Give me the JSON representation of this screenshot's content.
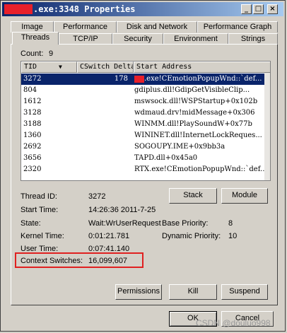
{
  "window": {
    "title": ".exe:3348 Properties",
    "minimize_glyph": "_",
    "maximize_glyph": "□",
    "close_glyph": "×"
  },
  "tabs_row1": [
    {
      "label": "Image"
    },
    {
      "label": "Performance"
    },
    {
      "label": "Disk and Network"
    },
    {
      "label": "Performance Graph"
    }
  ],
  "tabs_row2": [
    {
      "label": "Threads"
    },
    {
      "label": "TCP/IP"
    },
    {
      "label": "Security"
    },
    {
      "label": "Environment"
    },
    {
      "label": "Strings"
    }
  ],
  "count": {
    "label": "Count:",
    "value": "9"
  },
  "table": {
    "columns": [
      "TID",
      "CSwitch Delta",
      "Start Address"
    ],
    "sort_glyph": "▼",
    "rows": [
      {
        "tid": "3272",
        "delta": "178",
        "addr": ".exe!CEmotionPopupWnd::`def...",
        "selected": true
      },
      {
        "tid": "804",
        "delta": "",
        "addr": "gdiplus.dll!GdipGetVisibleClip...",
        "selected": false
      },
      {
        "tid": "1612",
        "delta": "",
        "addr": "mswsock.dll!WSPStartup+0x102b",
        "selected": false
      },
      {
        "tid": "3128",
        "delta": "",
        "addr": "wdmaud.drv!midMessage+0x306",
        "selected": false
      },
      {
        "tid": "3188",
        "delta": "",
        "addr": "WINMM.dll!PlaySoundW+0x77b",
        "selected": false
      },
      {
        "tid": "1360",
        "delta": "",
        "addr": "WININET.dll!InternetLockReques...",
        "selected": false
      },
      {
        "tid": "2692",
        "delta": "",
        "addr": "SOGOUPY.IME+0x9bb3a",
        "selected": false
      },
      {
        "tid": "3656",
        "delta": "",
        "addr": "TAPD.dll+0x45a0",
        "selected": false
      },
      {
        "tid": "2320",
        "delta": "",
        "addr": "RTX.exe!CEmotionPopupWnd::`def...",
        "selected": false
      }
    ]
  },
  "details": {
    "thread_id_label": "Thread ID:",
    "thread_id": "3272",
    "start_time_label": "Start Time:",
    "start_time": "14:26:36  2011-7-25",
    "state_label": "State:",
    "state": "Wait:WrUserRequest",
    "base_priority_label": "Base Priority:",
    "base_priority": "8",
    "kernel_time_label": "Kernel Time:",
    "kernel_time": "0:01:21.781",
    "dynamic_priority_label": "Dynamic Priority:",
    "dynamic_priority": "10",
    "user_time_label": "User Time:",
    "user_time": "0:07:41.140",
    "context_switches_label": "Context Switches:",
    "context_switches": "16,099,607"
  },
  "buttons": {
    "stack": "Stack",
    "module": "Module",
    "permissions": "Permissions",
    "kill": "Kill",
    "suspend": "Suspend",
    "ok": "OK",
    "cancel": "Cancel"
  },
  "watermark": "CSDN @douluo998",
  "colors": {
    "title_bar": "#0a246a",
    "selection": "#0a246a",
    "highlight_box": "#e02020",
    "redaction": "#e8202a"
  }
}
